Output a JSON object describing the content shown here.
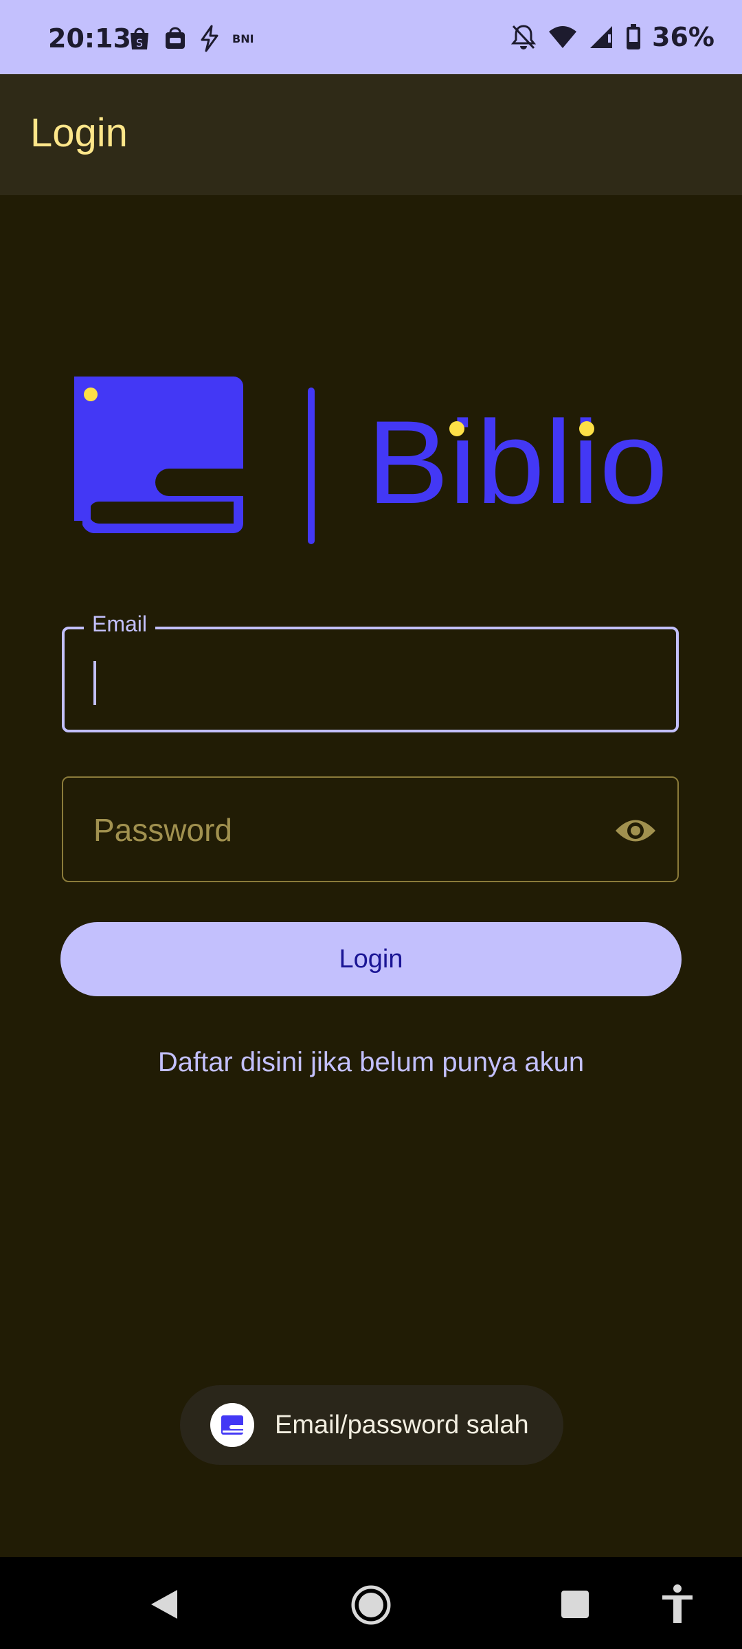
{
  "status_bar": {
    "time": "20:13",
    "notification_icons": [
      "shopee-icon",
      "bag-icon",
      "flash-icon",
      "bni-icon"
    ],
    "bni_text": "BNI",
    "right_icons": [
      "bell-off-icon",
      "wifi-icon",
      "signal-icon",
      "battery-icon"
    ],
    "battery_percent": "36%"
  },
  "app_bar": {
    "title": "Login"
  },
  "logo": {
    "text": "Biblio",
    "accent_color": "#4338f5",
    "dot_color": "#fde047"
  },
  "form": {
    "email": {
      "label": "Email",
      "value": ""
    },
    "password": {
      "placeholder": "Password",
      "value": ""
    },
    "login_button": "Login",
    "register_link": "Daftar disini jika belum punya akun"
  },
  "toast": {
    "message": "Email/password salah"
  },
  "colors": {
    "background": "#211c05",
    "app_bar": "#2f2a17",
    "primary": "#c3c0fd",
    "on_primary": "#1a1595",
    "title": "#fde68a"
  }
}
